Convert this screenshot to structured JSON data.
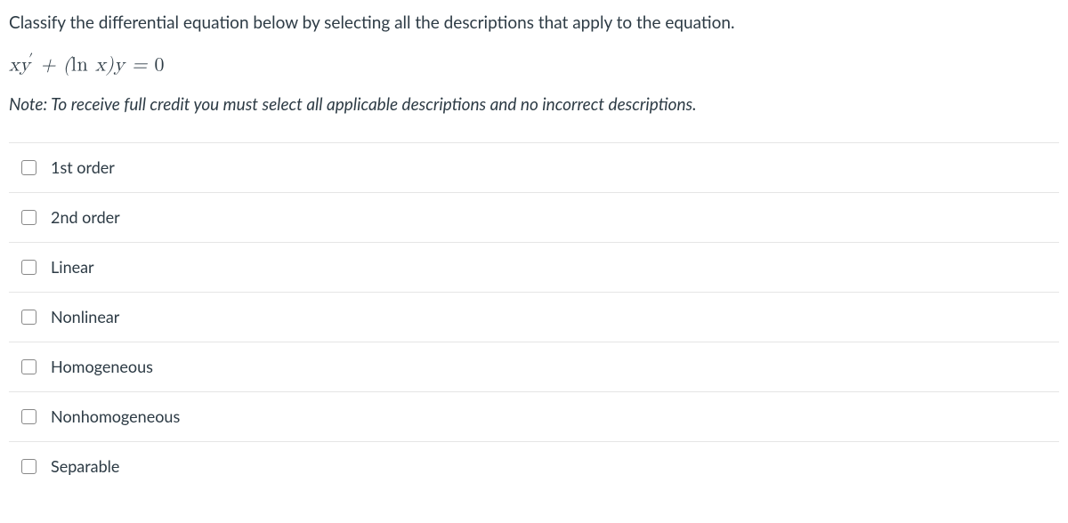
{
  "question": {
    "prompt": "Classify the differential equation below by selecting all the descriptions that apply to the equation.",
    "note": "Note: To receive full credit you must select all applicable descriptions and no incorrect descriptions."
  },
  "equation": {
    "display": "xy′ + (ln x)y = 0"
  },
  "options": [
    {
      "label": "1st order"
    },
    {
      "label": "2nd order"
    },
    {
      "label": "Linear"
    },
    {
      "label": "Nonlinear"
    },
    {
      "label": "Homogeneous"
    },
    {
      "label": "Nonhomogeneous"
    },
    {
      "label": "Separable"
    }
  ]
}
